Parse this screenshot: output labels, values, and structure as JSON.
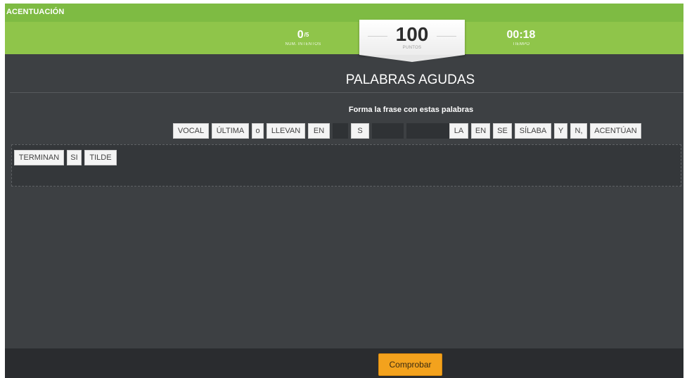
{
  "header": {
    "title": "ACENTUACIÓN"
  },
  "scoreboard": {
    "attempts_value": "0",
    "attempts_total": "/5",
    "attempts_label": "NUM. INTENTOS",
    "points_value": "100",
    "points_label": "PUNTOS",
    "time_value": "00:18",
    "time_label": "TIEMPO"
  },
  "exercise": {
    "title": "PALABRAS AGUDAS",
    "instructions": "Forma la frase con estas palabras",
    "word_bank": [
      "VOCAL",
      "ÚLTIMA",
      "o",
      "LLEVAN",
      "EN",
      "",
      "S",
      "",
      "",
      "LA",
      "EN",
      "SE",
      "SÍLABA",
      "Y",
      "N,",
      "ACENTÚAN"
    ],
    "answer_words": [
      "TERMINAN",
      "SI",
      "TILDE"
    ]
  },
  "footer": {
    "check_label": "Comprobar"
  },
  "colors": {
    "header_green": "#7ebb43",
    "score_green": "#8fc54a",
    "background": "#3d4043",
    "button_orange": "#f3a21d"
  }
}
